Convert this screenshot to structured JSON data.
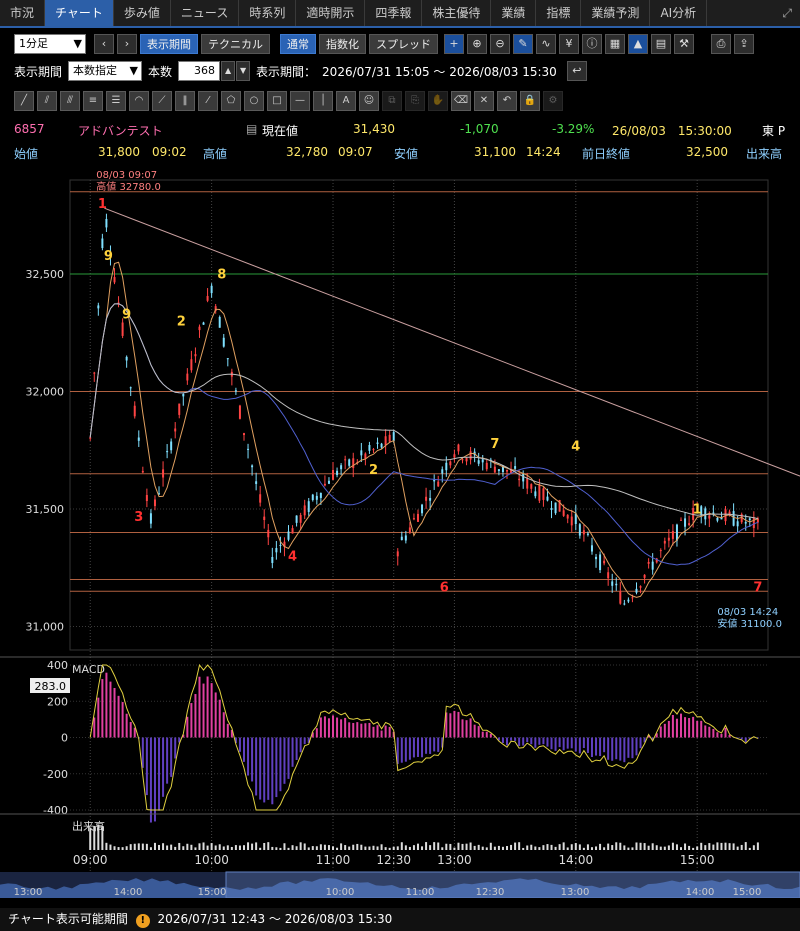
{
  "tabs": [
    "市況",
    "チャート",
    "歩み値",
    "ニュース",
    "時系列",
    "適時開示",
    "四季報",
    "株主優待",
    "業績",
    "指標",
    "業績予測",
    "AI分析"
  ],
  "active_tab": "チャート",
  "toolbar": {
    "interval": "1分足",
    "btn_period": "表示期間",
    "btn_technical": "テクニカル",
    "btn_normal": "通常",
    "btn_index": "指数化",
    "btn_spread": "スプレッド"
  },
  "period_row": {
    "label_period": "表示期間",
    "period_select": "本数指定",
    "label_count": "本数",
    "count_value": "368",
    "label_range": "表示期間：",
    "range_value": "2026/07/31 15:05 ～ 2026/08/03 15:30"
  },
  "quote": {
    "code": "6857",
    "name": "アドバンテスト",
    "label_current": "現在値",
    "current": "31,430",
    "change": "-1,070",
    "change_pct": "-3.29%",
    "datetime": "26/08/03　15:30:00",
    "market": "東 P",
    "label_open": "始値",
    "open": "31,800",
    "open_time": "09:02",
    "label_high": "高値",
    "high": "32,780",
    "high_time": "09:07",
    "label_low": "安値",
    "low": "31,100",
    "low_time": "14:24",
    "label_prev": "前日終値",
    "prev_close": "32,500",
    "label_volume": "出来高"
  },
  "chart": {
    "price_ticks": [
      "32,500",
      "32,000",
      "31,500",
      "31,000"
    ],
    "high_annotation_1": "08/03 09:07",
    "high_annotation_2": "高値 32780.0",
    "low_annotation_1": "08/03 14:24",
    "low_annotation_2": "安値 31100.0",
    "macd_label": "MACD",
    "macd_value": "283.0",
    "macd_ticks": [
      "400",
      "200",
      "0",
      "-200",
      "-400"
    ],
    "volume_label": "出来高",
    "time_ticks": [
      "09:00",
      "10:00",
      "11:00",
      "12:30",
      "13:00",
      "14:00",
      "15:00"
    ],
    "nav_ticks": [
      "13:00",
      "14:00",
      "15:00",
      "10:00",
      "11:00",
      "12:30",
      "13:00",
      "14:00",
      "15:00"
    ]
  },
  "chart_data": {
    "type": "line",
    "title": "6857 アドバンテスト 1分足",
    "x": [
      "09:00",
      "09:07",
      "09:30",
      "10:00",
      "10:30",
      "11:00",
      "11:30",
      "12:30",
      "13:00",
      "13:30",
      "14:00",
      "14:24",
      "14:45",
      "15:00",
      "15:30"
    ],
    "series": [
      {
        "name": "price",
        "values": [
          31800,
          32780,
          31450,
          32450,
          31300,
          31650,
          31800,
          31300,
          31750,
          31650,
          31450,
          31100,
          31350,
          31500,
          31430
        ]
      }
    ],
    "ylim": [
      30900,
      32900
    ],
    "macd_ylim": [
      -400,
      400
    ]
  },
  "footer": {
    "label": "チャート表示可能期間",
    "range": "2026/07/31 12:43 ～ 2026/08/03 15:30"
  },
  "colors": {
    "accent": "#2c5fa8",
    "up": "#ff4444",
    "down": "#7fe0ff",
    "signal": "#ffd23c"
  }
}
